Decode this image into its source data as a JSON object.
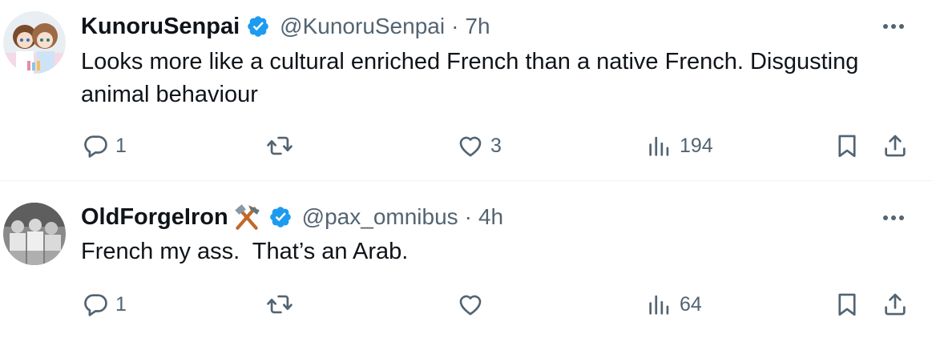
{
  "tweets": [
    {
      "display_name": "KunoruSenpai",
      "handle": "@KunoruSenpai",
      "separator": "·",
      "time": "7h",
      "verified": true,
      "name_emoji": "",
      "text": "Looks more like a cultural enriched French than a native French. Disgusting animal behaviour",
      "actions": {
        "reply_count": "1",
        "retweet_count": "",
        "like_count": "3",
        "views_count": "194"
      }
    },
    {
      "display_name": "OldForgeIron",
      "handle": "@pax_omnibus",
      "separator": "·",
      "time": "4h",
      "verified": true,
      "name_emoji": "hammer-and-pick",
      "text": "French my ass.  That’s an Arab.",
      "actions": {
        "reply_count": "1",
        "retweet_count": "",
        "like_count": "",
        "views_count": "64"
      }
    }
  ],
  "icons": {
    "more": "more-dots-icon",
    "reply": "reply-icon",
    "retweet": "retweet-icon",
    "like": "heart-icon",
    "views": "views-icon",
    "bookmark": "bookmark-icon",
    "share": "share-icon",
    "verified": "verified-badge-icon"
  },
  "colors": {
    "verified": "#1d9bf0",
    "secondary_text": "#536471",
    "primary_text": "#0f1419",
    "divider": "#eff3f4"
  }
}
